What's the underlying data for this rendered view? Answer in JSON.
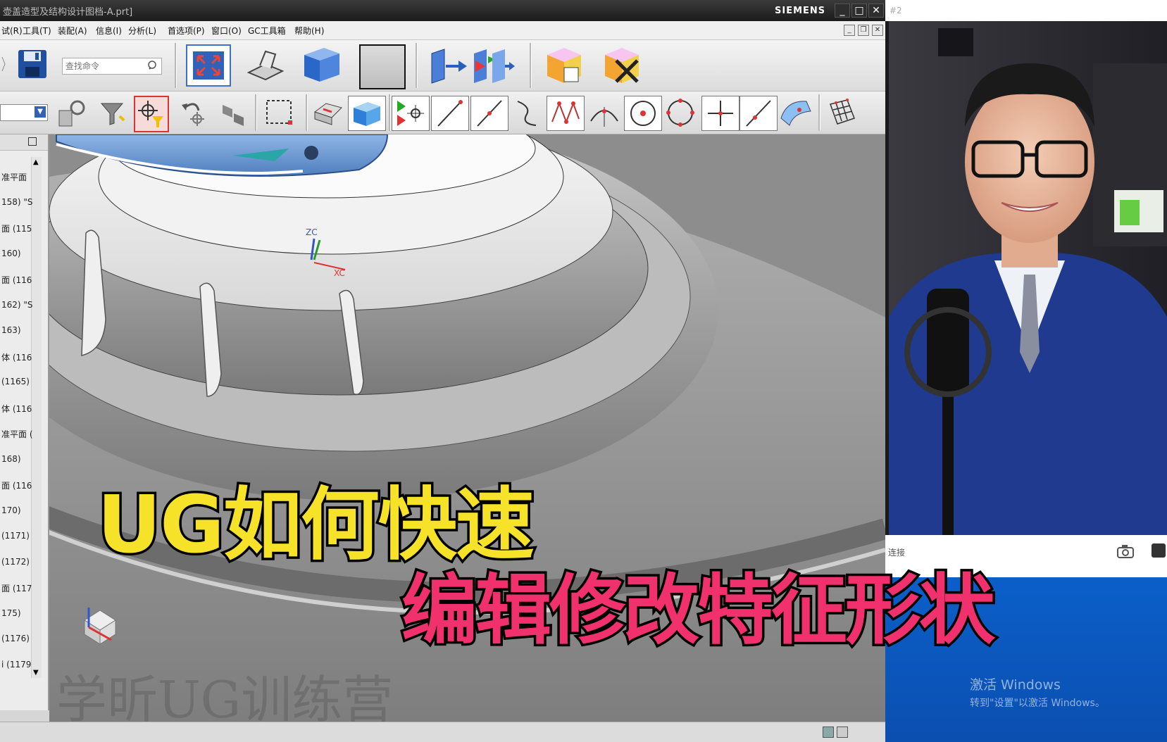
{
  "window": {
    "title": "壶盖造型及结构设计图档-A.prt]",
    "brand": "SIEMENS",
    "buttons": [
      "_",
      "□",
      "✕"
    ]
  },
  "menu": {
    "items": [
      "试(R)",
      "工具(T)",
      "装配(A)",
      "信息(I)",
      "分析(L)",
      "首选项(P)",
      "窗口(O)",
      "GC工具箱",
      "帮助(H)"
    ]
  },
  "search": {
    "placeholder": "查找命令"
  },
  "nav": {
    "items": [
      "准平面",
      "158) \"S",
      "面 (115",
      "160)",
      "面 (116",
      "162) \"S",
      "163)",
      "体 (116",
      "(1165)",
      "体 (116",
      "准平面 (",
      "168)",
      "面 (116",
      "170)",
      "(1171)",
      "(1172)",
      "面 (117",
      "175)",
      "(1176)",
      "i (1179"
    ]
  },
  "viewport": {
    "axis_z": "ZC",
    "axis_x": "XC",
    "watermark": "学昕UG训练营"
  },
  "captions": {
    "line1": "UG如何快速",
    "line2": "编辑修改特征形状"
  },
  "side": {
    "tab_hint": "#2",
    "connect": "连接",
    "activate_title": "激活 Windows",
    "activate_sub": "转到\"设置\"以激活 Windows。"
  },
  "colors": {
    "caption1": "#f7e22a",
    "caption2": "#f0316e",
    "accent_blue": "#0b5fc9"
  }
}
